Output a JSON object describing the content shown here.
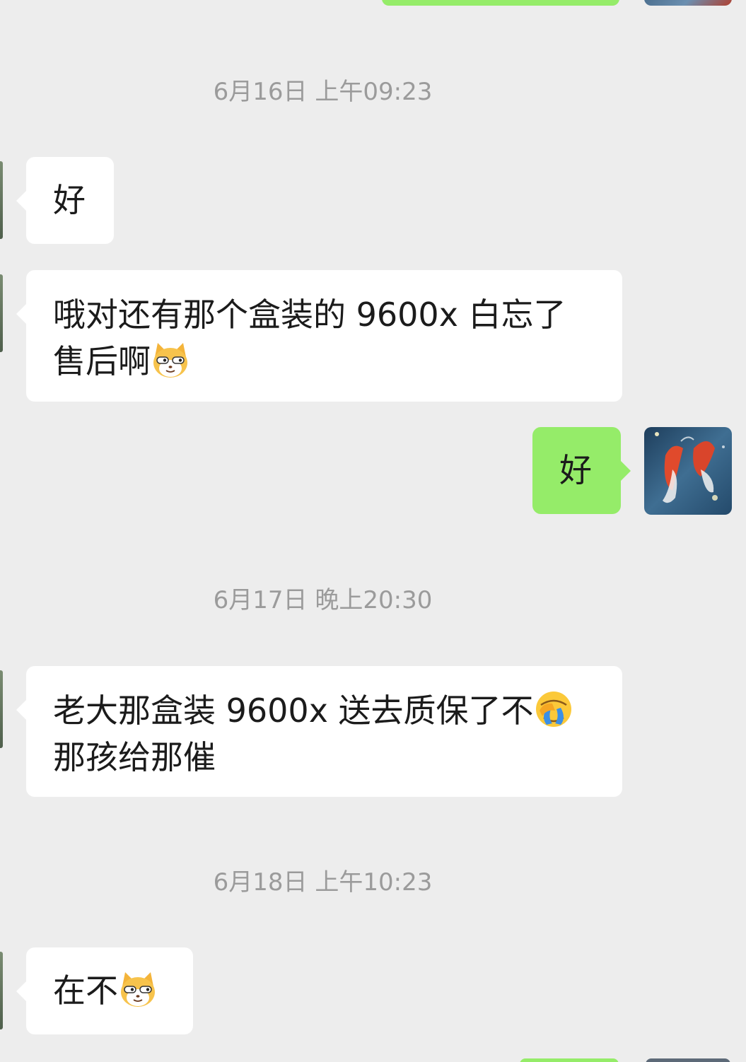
{
  "messages": [
    {
      "type": "timestamp",
      "text": "6月16日 上午09:23"
    },
    {
      "type": "incoming",
      "text": "好"
    },
    {
      "type": "incoming",
      "line1": "哦对还有那个盒装的 9600x 白忘了",
      "line2": "售后啊",
      "emoji": "cat-grin-emoji"
    },
    {
      "type": "outgoing",
      "text": "好",
      "avatar": "koi-fish-avatar"
    },
    {
      "type": "timestamp",
      "text": "6月17日 晚上20:30"
    },
    {
      "type": "incoming",
      "line1": "老大那盒装 9600x 送去质保了不",
      "line2": "那孩给那催",
      "emoji": "facepalm-emoji"
    },
    {
      "type": "timestamp",
      "text": "6月18日 上午10:23"
    },
    {
      "type": "incoming",
      "text": "在不",
      "emoji": "cat-grin-emoji"
    }
  ],
  "colors": {
    "background": "#ededed",
    "incoming_bubble": "#ffffff",
    "outgoing_bubble": "#95ec69",
    "timestamp_text": "#9b9b9b"
  }
}
